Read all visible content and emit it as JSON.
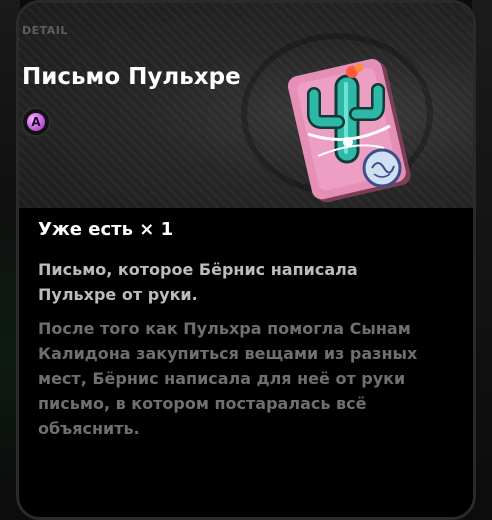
{
  "panel": {
    "section_label": "DETAIL",
    "item_title": "Письмо Пульхре",
    "rank": "A",
    "owned_text": "Уже есть × 1",
    "description": "Письмо, которое Бёрнис написала Пульхре от руки.",
    "lore": "После того как Пульхра помогла Сынам Калидона закупиться вещами из разных мест, Бёрнис написала для неё от руки письмо, в котором постаралась всё объяснить."
  },
  "colors": {
    "card_bg": "#050505",
    "header_bg": "#262626",
    "rank_accent": "#c35bdf",
    "title_text": "#ffffff",
    "description_text": "#bcbcbc",
    "lore_text": "#6f6f6f"
  },
  "icons": {
    "item_icon": "cactus-letter-icon",
    "rank_icon": "rank-a-badge-icon"
  }
}
